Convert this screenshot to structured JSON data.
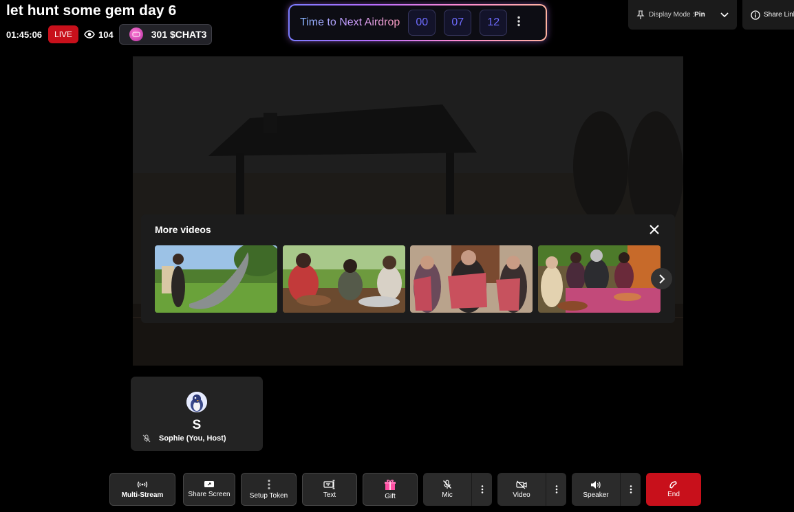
{
  "header": {
    "title": "let hunt some gem day 6",
    "duration": "01:45:06",
    "live_label": "LIVE",
    "viewer_count": "104",
    "token_amount": "301 $CHAT3"
  },
  "airdrop": {
    "label": "Time to Next Airdrop",
    "hours": "00",
    "minutes": "07",
    "seconds": "12"
  },
  "top_right": {
    "display_mode_label": "Display Mode : ",
    "display_mode_value": "Pin",
    "share_link_label": "Share Link"
  },
  "more_videos": {
    "title": "More videos"
  },
  "participant": {
    "initial": "S",
    "name": "Sophie  (You, Host)"
  },
  "controls": {
    "multistream": "Multi-Stream",
    "share_screen": "Share Screen",
    "setup_token": "Setup Token",
    "text": "Text",
    "gift": "Gift",
    "mic": "Mic",
    "video": "Video",
    "speaker": "Speaker",
    "end": "End"
  },
  "colors": {
    "live": "#c8101b",
    "end": "#c8101b",
    "airdrop_digits": "#6f6cff"
  },
  "icons": [
    "eye-icon",
    "token-coin-icon",
    "more-vertical-icon",
    "pin-icon",
    "chevron-down-icon",
    "info-icon",
    "close-icon",
    "chevron-right-icon",
    "mic-off-icon",
    "live-stream-icon",
    "screen-share-icon",
    "text-icon",
    "gift-icon",
    "video-off-icon",
    "speaker-icon",
    "phone-end-icon"
  ]
}
